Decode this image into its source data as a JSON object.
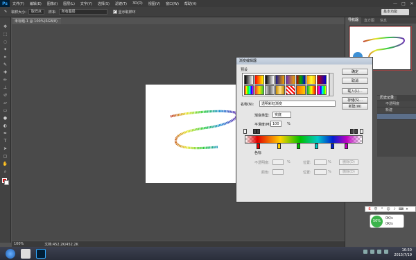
{
  "app": {
    "logo": "Ps",
    "window_controls": [
      "—",
      "□",
      "✕"
    ]
  },
  "menu": [
    "文件(F)",
    "编辑(E)",
    "图像(I)",
    "图层(L)",
    "文字(Y)",
    "选择(S)",
    "滤镜(T)",
    "3D(D)",
    "视图(V)",
    "窗口(W)",
    "帮助(H)"
  ],
  "options": {
    "sample_size_label": "取样大小:",
    "sample_size_value": "取样点",
    "sample_label": "样本:",
    "sample_value": "所有图层",
    "show_ring_label": "显示取样环"
  },
  "workspace_search": "基本功能",
  "document": {
    "tab_title": "未标题-1 @ 100%(RGB/8)"
  },
  "status": {
    "zoom": "100%",
    "doc_size": "文档:452.2K/452.2K"
  },
  "right_panel": {
    "tabs": [
      "导航器",
      "直方图",
      "信息"
    ],
    "history_tab": "历史记录",
    "history_items": [
      "不透明度",
      "新建",
      ""
    ]
  },
  "dialog": {
    "title": "渐变编辑器",
    "presets_label": "预设",
    "buttons": {
      "ok": "确定",
      "cancel": "取消",
      "load": "载入(L)...",
      "save": "存储(S)...",
      "new": "新建(W)"
    },
    "name_label": "名称(N):",
    "name_value": "透明彩虹渐变",
    "gradient_type_label": "渐变类型:",
    "gradient_type_value": "实底",
    "smoothness_label": "平滑度(M):",
    "smoothness_value": "100",
    "smoothness_unit": "%",
    "stops_label": "色标",
    "opacity_label": "不透明度:",
    "location_label": "位置:",
    "color_label": "颜色:",
    "percent": "%",
    "delete_label": "删除(D)"
  },
  "ime": {
    "speed": "50%",
    "up": "0K/s",
    "down": "0K/s"
  },
  "clock": {
    "time": "16:50",
    "date": "2015/7/19"
  }
}
